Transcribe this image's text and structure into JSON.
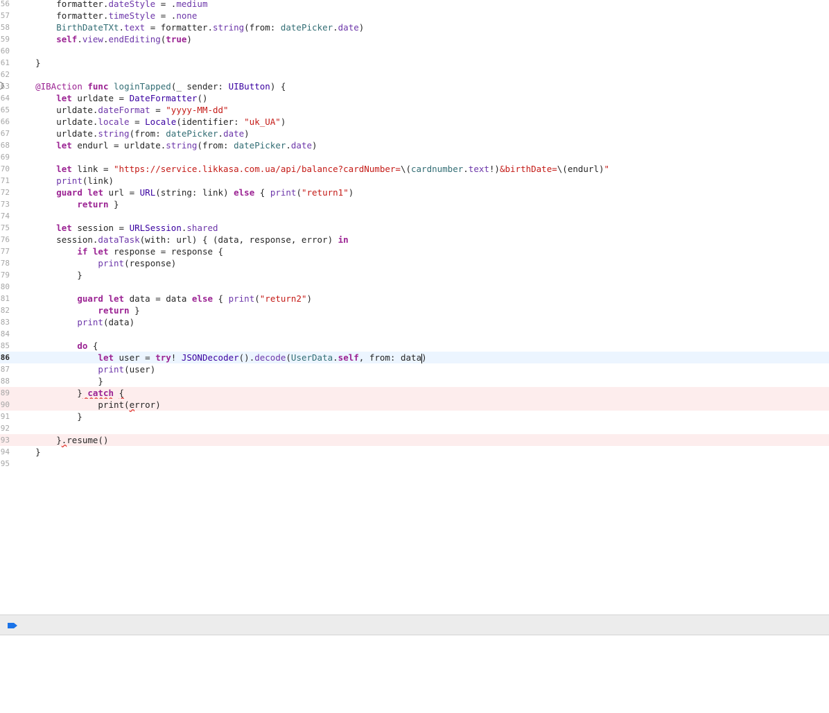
{
  "editor": {
    "lines": [
      {
        "num": "56",
        "state": "normal",
        "tokens": [
          {
            "t": "        formatter.",
            "c": "plain"
          },
          {
            "t": "dateStyle",
            "c": "prop"
          },
          {
            "t": " = .",
            "c": "plain"
          },
          {
            "t": "medium",
            "c": "prop"
          }
        ]
      },
      {
        "num": "57",
        "state": "normal",
        "tokens": [
          {
            "t": "        formatter.",
            "c": "plain"
          },
          {
            "t": "timeStyle",
            "c": "prop"
          },
          {
            "t": " = .",
            "c": "plain"
          },
          {
            "t": "none",
            "c": "prop"
          }
        ]
      },
      {
        "num": "58",
        "state": "normal",
        "tokens": [
          {
            "t": "        ",
            "c": "plain"
          },
          {
            "t": "BirthDateTXt",
            "c": "fn"
          },
          {
            "t": ".",
            "c": "plain"
          },
          {
            "t": "text",
            "c": "prop"
          },
          {
            "t": " = formatter.",
            "c": "plain"
          },
          {
            "t": "string",
            "c": "prop"
          },
          {
            "t": "(from: ",
            "c": "plain"
          },
          {
            "t": "datePicker",
            "c": "fn"
          },
          {
            "t": ".",
            "c": "plain"
          },
          {
            "t": "date",
            "c": "prop"
          },
          {
            "t": ")",
            "c": "plain"
          }
        ]
      },
      {
        "num": "59",
        "state": "normal",
        "tokens": [
          {
            "t": "        ",
            "c": "plain"
          },
          {
            "t": "self",
            "c": "kw"
          },
          {
            "t": ".",
            "c": "plain"
          },
          {
            "t": "view",
            "c": "prop"
          },
          {
            "t": ".",
            "c": "plain"
          },
          {
            "t": "endEditing",
            "c": "prop"
          },
          {
            "t": "(",
            "c": "plain"
          },
          {
            "t": "true",
            "c": "kw"
          },
          {
            "t": ")",
            "c": "plain"
          }
        ]
      },
      {
        "num": "60",
        "state": "normal",
        "tokens": []
      },
      {
        "num": "61",
        "state": "normal",
        "tokens": [
          {
            "t": "    }",
            "c": "plain"
          }
        ]
      },
      {
        "num": "62",
        "state": "normal",
        "tokens": []
      },
      {
        "num": "63",
        "state": "breakpoint",
        "tokens": [
          {
            "t": "    ",
            "c": "plain"
          },
          {
            "t": "@IBAction",
            "c": "attr"
          },
          {
            "t": " ",
            "c": "plain"
          },
          {
            "t": "func",
            "c": "kw"
          },
          {
            "t": " ",
            "c": "plain"
          },
          {
            "t": "loginTapped",
            "c": "fn"
          },
          {
            "t": "(_ sender: ",
            "c": "plain"
          },
          {
            "t": "UIButton",
            "c": "ty"
          },
          {
            "t": ") {",
            "c": "plain"
          }
        ]
      },
      {
        "num": "64",
        "state": "normal",
        "tokens": [
          {
            "t": "        ",
            "c": "plain"
          },
          {
            "t": "let",
            "c": "kw"
          },
          {
            "t": " urldate = ",
            "c": "plain"
          },
          {
            "t": "DateFormatter",
            "c": "ty"
          },
          {
            "t": "()",
            "c": "plain"
          }
        ]
      },
      {
        "num": "65",
        "state": "normal",
        "tokens": [
          {
            "t": "        urldate.",
            "c": "plain"
          },
          {
            "t": "dateFormat",
            "c": "prop"
          },
          {
            "t": " = ",
            "c": "plain"
          },
          {
            "t": "\"yyyy-MM-dd\"",
            "c": "str"
          }
        ]
      },
      {
        "num": "66",
        "state": "normal",
        "tokens": [
          {
            "t": "        urldate.",
            "c": "plain"
          },
          {
            "t": "locale",
            "c": "prop"
          },
          {
            "t": " = ",
            "c": "plain"
          },
          {
            "t": "Locale",
            "c": "ty"
          },
          {
            "t": "(identifier: ",
            "c": "plain"
          },
          {
            "t": "\"uk_UA\"",
            "c": "str"
          },
          {
            "t": ")",
            "c": "plain"
          }
        ]
      },
      {
        "num": "67",
        "state": "normal",
        "tokens": [
          {
            "t": "        urldate.",
            "c": "plain"
          },
          {
            "t": "string",
            "c": "prop"
          },
          {
            "t": "(from: ",
            "c": "plain"
          },
          {
            "t": "datePicker",
            "c": "fn"
          },
          {
            "t": ".",
            "c": "plain"
          },
          {
            "t": "date",
            "c": "prop"
          },
          {
            "t": ")",
            "c": "plain"
          }
        ]
      },
      {
        "num": "68",
        "state": "normal",
        "tokens": [
          {
            "t": "        ",
            "c": "plain"
          },
          {
            "t": "let",
            "c": "kw"
          },
          {
            "t": " endurl = urldate.",
            "c": "plain"
          },
          {
            "t": "string",
            "c": "prop"
          },
          {
            "t": "(from: ",
            "c": "plain"
          },
          {
            "t": "datePicker",
            "c": "fn"
          },
          {
            "t": ".",
            "c": "plain"
          },
          {
            "t": "date",
            "c": "prop"
          },
          {
            "t": ")",
            "c": "plain"
          }
        ]
      },
      {
        "num": "69",
        "state": "normal",
        "tokens": []
      },
      {
        "num": "70",
        "state": "normal",
        "tokens": [
          {
            "t": "        ",
            "c": "plain"
          },
          {
            "t": "let",
            "c": "kw"
          },
          {
            "t": " link = ",
            "c": "plain"
          },
          {
            "t": "\"https://service.likkasa.com.ua/api/balance?cardNumber=",
            "c": "str"
          },
          {
            "t": "\\(",
            "c": "plain"
          },
          {
            "t": "cardnumber",
            "c": "fn"
          },
          {
            "t": ".",
            "c": "plain"
          },
          {
            "t": "text",
            "c": "prop"
          },
          {
            "t": "!)",
            "c": "plain"
          },
          {
            "t": "&birthDate=",
            "c": "str"
          },
          {
            "t": "\\(endurl)",
            "c": "plain"
          },
          {
            "t": "\"",
            "c": "str"
          }
        ]
      },
      {
        "num": "71",
        "state": "normal",
        "tokens": [
          {
            "t": "        ",
            "c": "plain"
          },
          {
            "t": "print",
            "c": "prop"
          },
          {
            "t": "(link)",
            "c": "plain"
          }
        ]
      },
      {
        "num": "72",
        "state": "normal",
        "tokens": [
          {
            "t": "        ",
            "c": "plain"
          },
          {
            "t": "guard",
            "c": "kw"
          },
          {
            "t": " ",
            "c": "plain"
          },
          {
            "t": "let",
            "c": "kw"
          },
          {
            "t": " url = ",
            "c": "plain"
          },
          {
            "t": "URL",
            "c": "ty"
          },
          {
            "t": "(string: link) ",
            "c": "plain"
          },
          {
            "t": "else",
            "c": "kw"
          },
          {
            "t": " { ",
            "c": "plain"
          },
          {
            "t": "print",
            "c": "prop"
          },
          {
            "t": "(",
            "c": "plain"
          },
          {
            "t": "\"return1\"",
            "c": "str"
          },
          {
            "t": ")",
            "c": "plain"
          }
        ]
      },
      {
        "num": "73",
        "state": "normal",
        "tokens": [
          {
            "t": "            ",
            "c": "plain"
          },
          {
            "t": "return",
            "c": "kw"
          },
          {
            "t": " }",
            "c": "plain"
          }
        ]
      },
      {
        "num": "74",
        "state": "normal",
        "tokens": []
      },
      {
        "num": "75",
        "state": "normal",
        "tokens": [
          {
            "t": "        ",
            "c": "plain"
          },
          {
            "t": "let",
            "c": "kw"
          },
          {
            "t": " session = ",
            "c": "plain"
          },
          {
            "t": "URLSession",
            "c": "ty"
          },
          {
            "t": ".",
            "c": "plain"
          },
          {
            "t": "shared",
            "c": "prop"
          }
        ]
      },
      {
        "num": "76",
        "state": "normal",
        "tokens": [
          {
            "t": "        session.",
            "c": "plain"
          },
          {
            "t": "dataTask",
            "c": "prop"
          },
          {
            "t": "(with: url) { (data, response, error) ",
            "c": "plain"
          },
          {
            "t": "in",
            "c": "kw"
          }
        ]
      },
      {
        "num": "77",
        "state": "normal",
        "tokens": [
          {
            "t": "            ",
            "c": "plain"
          },
          {
            "t": "if",
            "c": "kw"
          },
          {
            "t": " ",
            "c": "plain"
          },
          {
            "t": "let",
            "c": "kw"
          },
          {
            "t": " response = response {",
            "c": "plain"
          }
        ]
      },
      {
        "num": "78",
        "state": "normal",
        "tokens": [
          {
            "t": "                ",
            "c": "plain"
          },
          {
            "t": "print",
            "c": "prop"
          },
          {
            "t": "(response)",
            "c": "plain"
          }
        ]
      },
      {
        "num": "79",
        "state": "normal",
        "tokens": [
          {
            "t": "            }",
            "c": "plain"
          }
        ]
      },
      {
        "num": "80",
        "state": "normal",
        "tokens": []
      },
      {
        "num": "81",
        "state": "normal",
        "tokens": [
          {
            "t": "            ",
            "c": "plain"
          },
          {
            "t": "guard",
            "c": "kw"
          },
          {
            "t": " ",
            "c": "plain"
          },
          {
            "t": "let",
            "c": "kw"
          },
          {
            "t": " data = data ",
            "c": "plain"
          },
          {
            "t": "else",
            "c": "kw"
          },
          {
            "t": " { ",
            "c": "plain"
          },
          {
            "t": "print",
            "c": "prop"
          },
          {
            "t": "(",
            "c": "plain"
          },
          {
            "t": "\"return2\"",
            "c": "str"
          },
          {
            "t": ")",
            "c": "plain"
          }
        ]
      },
      {
        "num": "82",
        "state": "normal",
        "tokens": [
          {
            "t": "                ",
            "c": "plain"
          },
          {
            "t": "return",
            "c": "kw"
          },
          {
            "t": " }",
            "c": "plain"
          }
        ]
      },
      {
        "num": "83",
        "state": "normal",
        "tokens": [
          {
            "t": "            ",
            "c": "plain"
          },
          {
            "t": "print",
            "c": "prop"
          },
          {
            "t": "(data)",
            "c": "plain"
          }
        ]
      },
      {
        "num": "84",
        "state": "normal",
        "tokens": []
      },
      {
        "num": "85",
        "state": "normal",
        "tokens": [
          {
            "t": "            ",
            "c": "plain"
          },
          {
            "t": "do",
            "c": "kw"
          },
          {
            "t": " {",
            "c": "plain"
          }
        ]
      },
      {
        "num": "86",
        "state": "current",
        "tokens": [
          {
            "t": "                ",
            "c": "plain"
          },
          {
            "t": "let",
            "c": "kw"
          },
          {
            "t": " user = ",
            "c": "plain"
          },
          {
            "t": "try",
            "c": "kw"
          },
          {
            "t": "! ",
            "c": "plain"
          },
          {
            "t": "JSONDecoder",
            "c": "ty"
          },
          {
            "t": "().",
            "c": "plain"
          },
          {
            "t": "decode",
            "c": "prop"
          },
          {
            "t": "(",
            "c": "plain"
          },
          {
            "t": "UserData",
            "c": "fn"
          },
          {
            "t": ".",
            "c": "plain"
          },
          {
            "t": "self",
            "c": "kw"
          },
          {
            "t": ", from: data",
            "c": "plain"
          },
          {
            "t": "",
            "c": "caret"
          },
          {
            "t": ")",
            "c": "plain"
          }
        ]
      },
      {
        "num": "87",
        "state": "normal",
        "tokens": [
          {
            "t": "                ",
            "c": "plain"
          },
          {
            "t": "print",
            "c": "prop"
          },
          {
            "t": "(user)",
            "c": "plain"
          }
        ]
      },
      {
        "num": "88",
        "state": "normal",
        "tokens": [
          {
            "t": "                }",
            "c": "plain"
          }
        ]
      },
      {
        "num": "89",
        "state": "error",
        "tokens": [
          {
            "t": "            }",
            "c": "plain"
          },
          {
            "t": " ",
            "c": "squig"
          },
          {
            "t": "catch",
            "c": "kw squig"
          },
          {
            "t": " ",
            "c": "plain"
          },
          {
            "t": "{",
            "c": "squig"
          }
        ]
      },
      {
        "num": "90",
        "state": "error",
        "tokens": [
          {
            "t": "                print(",
            "c": "plain"
          },
          {
            "t": "e",
            "c": "squig"
          },
          {
            "t": "rror)",
            "c": "plain"
          }
        ]
      },
      {
        "num": "91",
        "state": "normal",
        "tokens": [
          {
            "t": "            }",
            "c": "plain"
          }
        ]
      },
      {
        "num": "92",
        "state": "normal",
        "tokens": []
      },
      {
        "num": "93",
        "state": "error",
        "tokens": [
          {
            "t": "        }",
            "c": "plain"
          },
          {
            "t": ".",
            "c": "squig"
          },
          {
            "t": "resume()",
            "c": "plain"
          }
        ]
      },
      {
        "num": "94",
        "state": "normal",
        "tokens": [
          {
            "t": "    }",
            "c": "plain"
          }
        ]
      },
      {
        "num": "95",
        "state": "normal",
        "tokens": []
      }
    ]
  },
  "debug_bar": {
    "breakpoint_icon": "breakpoint-icon",
    "breakpoint_color": "#1a73e8"
  },
  "colors": {
    "current_line": "#ecf5ff",
    "error_line": "#fdeded",
    "keyword": "#9b2393",
    "string": "#c41a16"
  }
}
